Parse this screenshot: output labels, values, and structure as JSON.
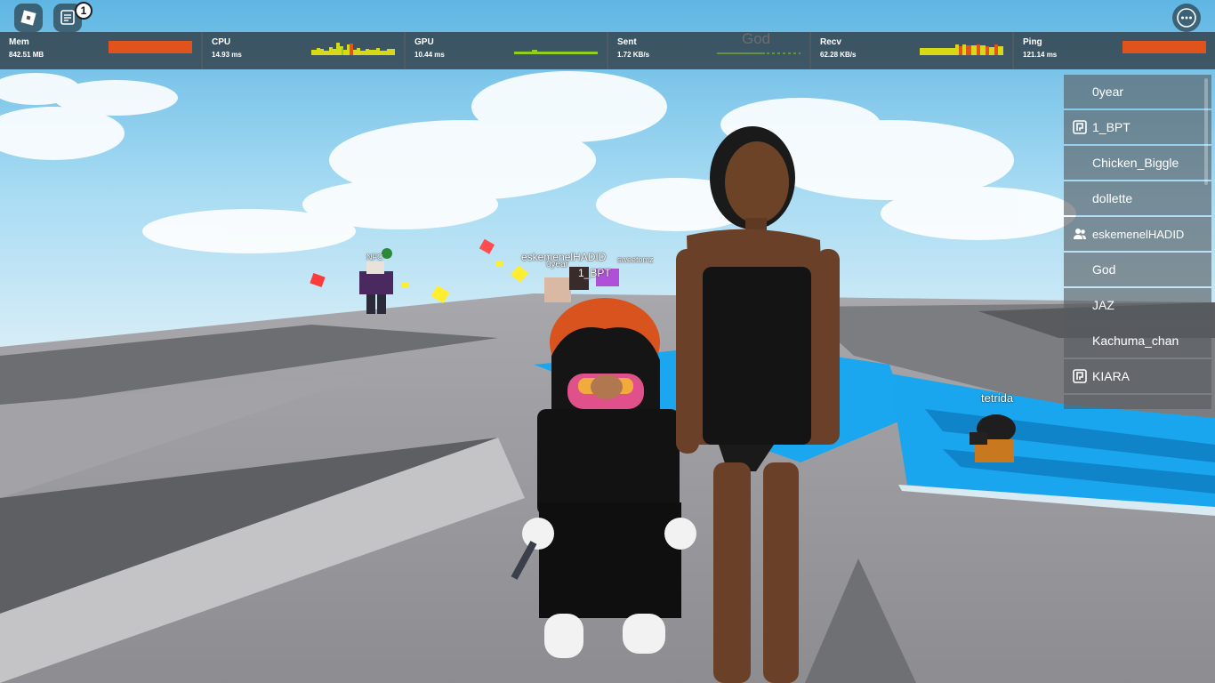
{
  "topbar": {
    "chat_badge_count": "1"
  },
  "stats": [
    {
      "label": "Mem",
      "value": "842.51 MB"
    },
    {
      "label": "CPU",
      "value": "14.93 ms"
    },
    {
      "label": "GPU",
      "value": "10.44 ms"
    },
    {
      "label": "Sent",
      "value": "1.72 KB/s",
      "overlay": "God"
    },
    {
      "label": "Recv",
      "value": "62.28 KB/s"
    },
    {
      "label": "Ping",
      "value": "121.14 ms"
    }
  ],
  "players": [
    {
      "name": "0year",
      "icon": "none"
    },
    {
      "name": "1_BPT",
      "icon": "premium-icon"
    },
    {
      "name": "Chicken_Biggle",
      "icon": "none"
    },
    {
      "name": "dollette",
      "icon": "none"
    },
    {
      "name": "eskemenelHADID",
      "icon": "friends-icon"
    },
    {
      "name": "God",
      "icon": "none"
    },
    {
      "name": "JAZ",
      "icon": "none"
    },
    {
      "name": "Kachuma_chan",
      "icon": "none"
    },
    {
      "name": "KIARA",
      "icon": "premium-icon"
    }
  ],
  "nametags": {
    "tetrida": "tetrida",
    "eskemenel": "eskemenelHADID",
    "oyear": "0year",
    "bpt": "1_BPT",
    "sweetomz": "sweetomz",
    "nfc": "NFC"
  },
  "colors": {
    "stat_bar_orange": "#e0531d",
    "graph_yellow": "#d7d816",
    "graph_green": "#8fcf22",
    "water_blue": "#19a6ee"
  }
}
